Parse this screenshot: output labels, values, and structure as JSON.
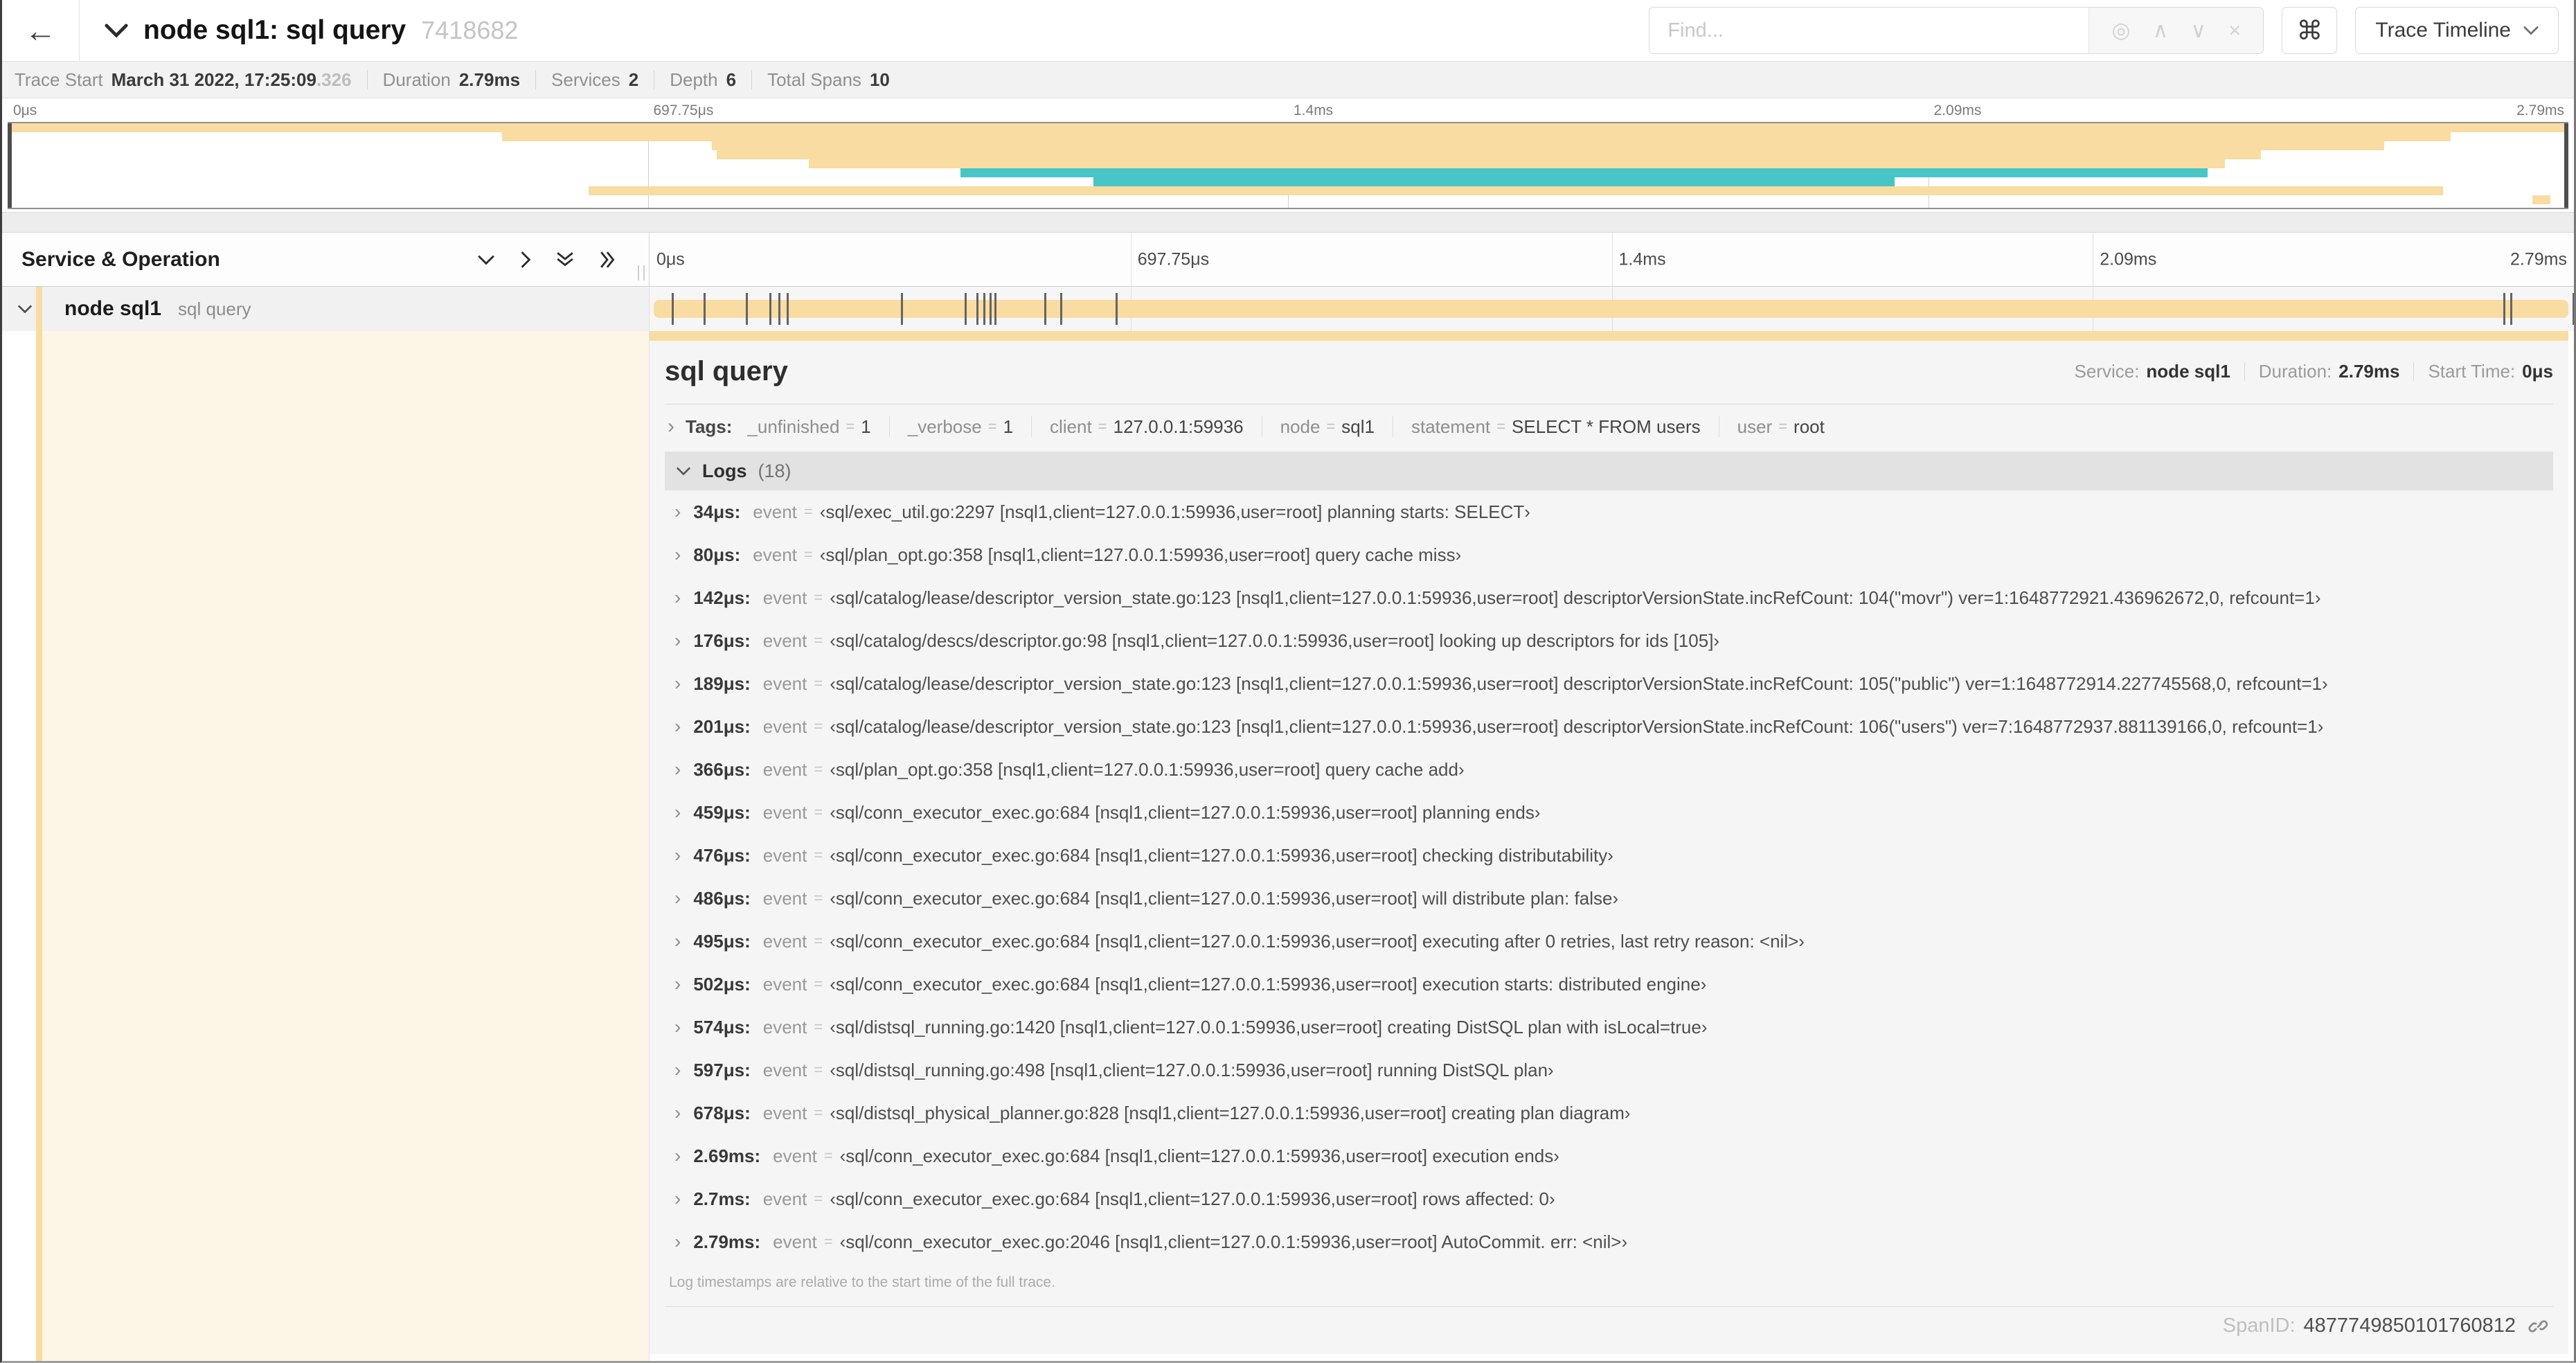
{
  "header": {
    "back_icon": "←",
    "title": "node sql1: sql query",
    "trace_id": "7418682",
    "find_placeholder": "Find...",
    "find_icons": [
      {
        "name": "locate-icon",
        "glyph": "◎"
      },
      {
        "name": "prev-match-icon",
        "glyph": "∧"
      },
      {
        "name": "next-match-icon",
        "glyph": "∨"
      },
      {
        "name": "clear-search-icon",
        "glyph": "×"
      }
    ],
    "shortcut_key": "⌘",
    "view_selector": "Trace Timeline"
  },
  "summary": {
    "items": [
      {
        "label": "Trace Start",
        "value": "March 31 2022, 17:25:09",
        "suffix": ".326"
      },
      {
        "label": "Duration",
        "value": "2.79ms"
      },
      {
        "label": "Services",
        "value": "2"
      },
      {
        "label": "Depth",
        "value": "6"
      },
      {
        "label": "Total Spans",
        "value": "10"
      }
    ]
  },
  "time_ticks": [
    {
      "label": "0μs",
      "pct": 0
    },
    {
      "label": "697.75μs",
      "pct": 25
    },
    {
      "label": "1.4ms",
      "pct": 50
    },
    {
      "label": "2.09ms",
      "pct": 75
    },
    {
      "label": "2.79ms",
      "pct": 100
    }
  ],
  "colors": {
    "span_tan": "#f8dca1",
    "span_teal": "#48c5c5",
    "detail_tint": "rgba(248,220,161,0.28)",
    "marker": "#646464"
  },
  "minimap": {
    "spans": [
      {
        "start_pct": 0,
        "end_pct": 100,
        "color": "tan"
      },
      {
        "start_pct": 19.3,
        "end_pct": 95.4,
        "color": "tan"
      },
      {
        "start_pct": 27.5,
        "end_pct": 92.8,
        "color": "tan"
      },
      {
        "start_pct": 27.7,
        "end_pct": 88.0,
        "color": "tan"
      },
      {
        "start_pct": 31.3,
        "end_pct": 86.6,
        "color": "tan"
      },
      {
        "start_pct": 37.2,
        "end_pct": 85.9,
        "color": "teal"
      },
      {
        "start_pct": 42.4,
        "end_pct": 73.7,
        "color": "teal"
      },
      {
        "start_pct": 22.7,
        "end_pct": 95.1,
        "color": "tan"
      },
      {
        "start_pct": 98.6,
        "end_pct": 99.3,
        "color": "tan"
      }
    ]
  },
  "grid": {
    "col_title": "Service & Operation"
  },
  "span_row": {
    "service": "node sql1",
    "operation": "sql query",
    "bar_start_pct": 0.2,
    "bar_end_pct": 99.7
  },
  "detail": {
    "title": "sql query",
    "meta": [
      {
        "label": "Service:",
        "value": "node sql1"
      },
      {
        "label": "Duration:",
        "value": "2.79ms"
      },
      {
        "label": "Start Time:",
        "value": "0μs"
      }
    ],
    "tags": {
      "label": "Tags:",
      "eq": "=",
      "items": [
        {
          "key": "_unfinished",
          "value": "1"
        },
        {
          "key": "_verbose",
          "value": "1"
        },
        {
          "key": "client",
          "value": "127.0.0.1:59936"
        },
        {
          "key": "node",
          "value": "sql1"
        },
        {
          "key": "statement",
          "value": "SELECT * FROM users"
        },
        {
          "key": "user",
          "value": "root"
        }
      ]
    },
    "logs": {
      "label": "Logs",
      "count": "(18)",
      "field": "event",
      "eq": "=",
      "total_us": 2790,
      "entries": [
        {
          "time": "34μs:",
          "us": 34,
          "value": "‹sql/exec_util.go:2297 [nsql1,client=127.0.0.1:59936,user=root] planning starts: SELECT›"
        },
        {
          "time": "80μs:",
          "us": 80,
          "value": "‹sql/plan_opt.go:358 [nsql1,client=127.0.0.1:59936,user=root] query cache miss›"
        },
        {
          "time": "142μs:",
          "us": 142,
          "value": "‹sql/catalog/lease/descriptor_version_state.go:123 [nsql1,client=127.0.0.1:59936,user=root] descriptorVersionState.incRefCount: 104(\"movr\") ver=1:1648772921.436962672,0, refcount=1›"
        },
        {
          "time": "176μs:",
          "us": 176,
          "value": "‹sql/catalog/descs/descriptor.go:98 [nsql1,client=127.0.0.1:59936,user=root] looking up descriptors for ids [105]›"
        },
        {
          "time": "189μs:",
          "us": 189,
          "value": "‹sql/catalog/lease/descriptor_version_state.go:123 [nsql1,client=127.0.0.1:59936,user=root] descriptorVersionState.incRefCount: 105(\"public\") ver=1:1648772914.227745568,0, refcount=1›"
        },
        {
          "time": "201μs:",
          "us": 201,
          "value": "‹sql/catalog/lease/descriptor_version_state.go:123 [nsql1,client=127.0.0.1:59936,user=root] descriptorVersionState.incRefCount: 106(\"users\") ver=7:1648772937.881139166,0, refcount=1›"
        },
        {
          "time": "366μs:",
          "us": 366,
          "value": "‹sql/plan_opt.go:358 [nsql1,client=127.0.0.1:59936,user=root] query cache add›"
        },
        {
          "time": "459μs:",
          "us": 459,
          "value": "‹sql/conn_executor_exec.go:684 [nsql1,client=127.0.0.1:59936,user=root] planning ends›"
        },
        {
          "time": "476μs:",
          "us": 476,
          "value": "‹sql/conn_executor_exec.go:684 [nsql1,client=127.0.0.1:59936,user=root] checking distributability›"
        },
        {
          "time": "486μs:",
          "us": 486,
          "value": "‹sql/conn_executor_exec.go:684 [nsql1,client=127.0.0.1:59936,user=root] will distribute plan: false›"
        },
        {
          "time": "495μs:",
          "us": 495,
          "value": "‹sql/conn_executor_exec.go:684 [nsql1,client=127.0.0.1:59936,user=root] executing after 0 retries, last retry reason: <nil>›"
        },
        {
          "time": "502μs:",
          "us": 502,
          "value": "‹sql/conn_executor_exec.go:684 [nsql1,client=127.0.0.1:59936,user=root] execution starts: distributed engine›"
        },
        {
          "time": "574μs:",
          "us": 574,
          "value": "‹sql/distsql_running.go:1420 [nsql1,client=127.0.0.1:59936,user=root] creating DistSQL plan with isLocal=true›"
        },
        {
          "time": "597μs:",
          "us": 597,
          "value": "‹sql/distsql_running.go:498 [nsql1,client=127.0.0.1:59936,user=root] running DistSQL plan›"
        },
        {
          "time": "678μs:",
          "us": 678,
          "value": "‹sql/distsql_physical_planner.go:828 [nsql1,client=127.0.0.1:59936,user=root] creating plan diagram›"
        },
        {
          "time": "2.69ms:",
          "us": 2690,
          "value": "‹sql/conn_executor_exec.go:684 [nsql1,client=127.0.0.1:59936,user=root] execution ends›"
        },
        {
          "time": "2.7ms:",
          "us": 2700,
          "value": "‹sql/conn_executor_exec.go:684 [nsql1,client=127.0.0.1:59936,user=root] rows affected: 0›"
        },
        {
          "time": "2.79ms:",
          "us": 2790,
          "value": "‹sql/conn_executor_exec.go:2046 [nsql1,client=127.0.0.1:59936,user=root] AutoCommit. err: <nil>›"
        }
      ],
      "footnote": "Log timestamps are relative to the start time of the full trace."
    },
    "span_id_label": "SpanID:",
    "span_id": "4877749850101760812"
  }
}
